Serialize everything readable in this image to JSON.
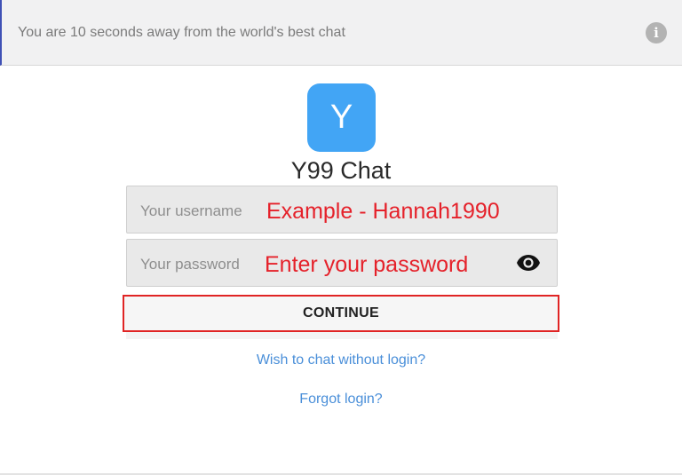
{
  "banner": {
    "text": "You are 10 seconds away from the world's best chat",
    "info_icon": "i"
  },
  "logo": {
    "letter": "Y",
    "color": "#42a5f5"
  },
  "app": {
    "title": "Y99 Chat"
  },
  "form": {
    "username": {
      "label": "Your username",
      "value": "Example - Hannah1990"
    },
    "password": {
      "label": "Your password",
      "value": "Enter your password",
      "toggle_icon": "eye-icon"
    },
    "continue_label": "CONTINUE"
  },
  "links": {
    "chat_without_login": "Wish to chat without login?",
    "forgot_login": "Forgot login?"
  },
  "colors": {
    "accent_link": "#4a8fd9",
    "annotation_red": "#e5212a",
    "banner_bg": "#f1f1f2"
  }
}
